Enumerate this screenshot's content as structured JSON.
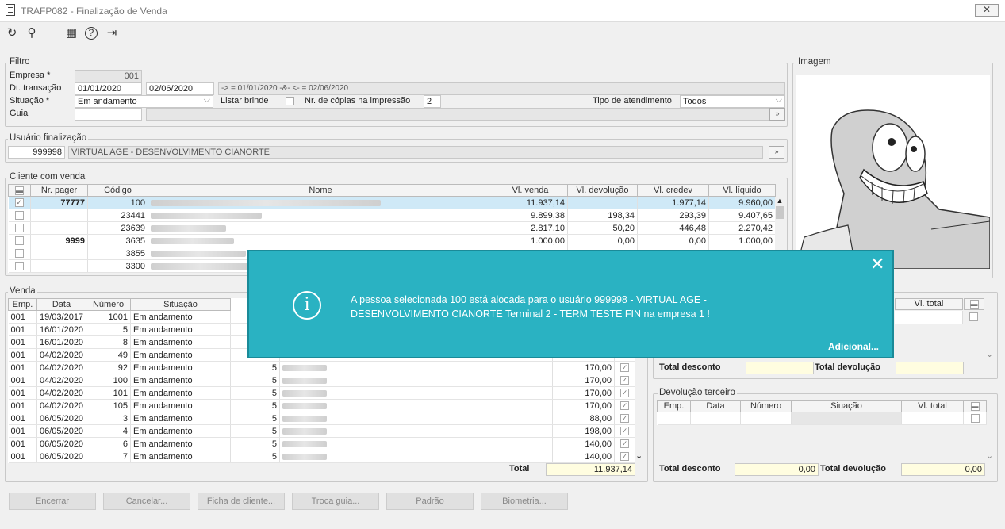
{
  "window": {
    "title": "TRAFP082 - Finalização de Venda",
    "close": "✕"
  },
  "toolbar": {
    "refresh": "↻",
    "search": "⚲",
    "calendar": "▦",
    "help": "?",
    "exit": "⇥"
  },
  "filtro": {
    "title": "Filtro",
    "empresa_label": "Empresa *",
    "empresa_value": "001",
    "dt_label": "Dt. transação",
    "dt_from": "01/01/2020",
    "dt_to": "02/06/2020",
    "dt_desc": "-> = 01/01/2020 -&- <- = 02/06/2020",
    "situacao_label": "Situação *",
    "situacao_value": "Em andamento",
    "listar_brinde_label": "Listar brinde",
    "copias_label": "Nr. de cópias na impressão",
    "copias_value": "2",
    "tipo_label": "Tipo de atendimento",
    "tipo_value": "Todos",
    "guia_label": "Guia"
  },
  "usuario": {
    "title": "Usuário finalização",
    "code": "999998",
    "name": "VIRTUAL AGE - DESENVOLVIMENTO CIANORTE"
  },
  "imagem": {
    "title": "Imagem"
  },
  "cliente": {
    "title": "Cliente com venda",
    "headers": [
      "Nr. pager",
      "Código",
      "Nome",
      "Vl. venda",
      "Vl. devolução",
      "Vl. credev",
      "Vl. líquido"
    ],
    "rows": [
      {
        "pager": "77777",
        "codigo": "100",
        "venda": "11.937,14",
        "devolucao": "",
        "credev": "1.977,14",
        "liquido": "9.960,00",
        "checked": true
      },
      {
        "pager": "",
        "codigo": "23441",
        "venda": "9.899,38",
        "devolucao": "198,34",
        "credev": "293,39",
        "liquido": "9.407,65",
        "checked": false
      },
      {
        "pager": "",
        "codigo": "23639",
        "venda": "2.817,10",
        "devolucao": "50,20",
        "credev": "446,48",
        "liquido": "2.270,42",
        "checked": false
      },
      {
        "pager": "9999",
        "codigo": "3635",
        "venda": "1.000,00",
        "devolucao": "0,00",
        "credev": "0,00",
        "liquido": "1.000,00",
        "checked": false
      },
      {
        "pager": "",
        "codigo": "3855",
        "venda": "",
        "devolucao": "",
        "credev": "",
        "liquido": "",
        "checked": false
      },
      {
        "pager": "",
        "codigo": "3300",
        "venda": "",
        "devolucao": "",
        "credev": "",
        "liquido": "",
        "checked": false
      }
    ]
  },
  "venda": {
    "title": "Venda",
    "headers": [
      "Emp.",
      "Data",
      "Número",
      "Situação"
    ],
    "rows": [
      {
        "emp": "001",
        "data": "19/03/2017",
        "numero": "1001",
        "situacao": "Em andamento",
        "qtd": "",
        "valor": ""
      },
      {
        "emp": "001",
        "data": "16/01/2020",
        "numero": "5",
        "situacao": "Em andamento",
        "qtd": "",
        "valor": ""
      },
      {
        "emp": "001",
        "data": "16/01/2020",
        "numero": "8",
        "situacao": "Em andamento",
        "qtd": "",
        "valor": ""
      },
      {
        "emp": "001",
        "data": "04/02/2020",
        "numero": "49",
        "situacao": "Em andamento",
        "qtd": "",
        "valor": ""
      },
      {
        "emp": "001",
        "data": "04/02/2020",
        "numero": "92",
        "situacao": "Em andamento",
        "qtd": "5",
        "valor": "170,00"
      },
      {
        "emp": "001",
        "data": "04/02/2020",
        "numero": "100",
        "situacao": "Em andamento",
        "qtd": "5",
        "valor": "170,00"
      },
      {
        "emp": "001",
        "data": "04/02/2020",
        "numero": "101",
        "situacao": "Em andamento",
        "qtd": "5",
        "valor": "170,00"
      },
      {
        "emp": "001",
        "data": "04/02/2020",
        "numero": "105",
        "situacao": "Em andamento",
        "qtd": "5",
        "valor": "170,00"
      },
      {
        "emp": "001",
        "data": "06/05/2020",
        "numero": "3",
        "situacao": "Em andamento",
        "qtd": "5",
        "valor": "88,00"
      },
      {
        "emp": "001",
        "data": "06/05/2020",
        "numero": "4",
        "situacao": "Em andamento",
        "qtd": "5",
        "valor": "198,00"
      },
      {
        "emp": "001",
        "data": "06/05/2020",
        "numero": "6",
        "situacao": "Em andamento",
        "qtd": "5",
        "valor": "140,00"
      },
      {
        "emp": "001",
        "data": "06/05/2020",
        "numero": "7",
        "situacao": "Em andamento",
        "qtd": "5",
        "valor": "140,00"
      }
    ],
    "total_label": "Total",
    "total_value": "11.937,14"
  },
  "right_top": {
    "vl_total": "Vl. total",
    "total_desconto": "Total desconto",
    "total_devolucao": "Total devolução"
  },
  "devolucao": {
    "title": "Devolução terceiro",
    "headers": [
      "Emp.",
      "Data",
      "Número",
      "Siuação",
      "Vl. total"
    ],
    "total_desconto_label": "Total desconto",
    "total_desconto_value": "0,00",
    "total_devolucao_label": "Total devolução",
    "total_devolucao_value": "0,00"
  },
  "buttons": [
    "Encerrar",
    "Cancelar...",
    "Ficha de cliente...",
    "Troca guia...",
    "Padrão",
    "Biometria..."
  ],
  "toast": {
    "message": "A pessoa selecionada 100 está alocada para o usuário 999998 - VIRTUAL AGE - DESENVOLVIMENTO CIANORTE Terminal 2 - TERM TESTE FIN na empresa 1 !",
    "more": "Adicional...",
    "icon": "i",
    "close": "✕"
  },
  "colors": {
    "toast": "#2ab2c2",
    "selected_row": "#cfe9f7",
    "readonly": "#e6e6e6"
  }
}
